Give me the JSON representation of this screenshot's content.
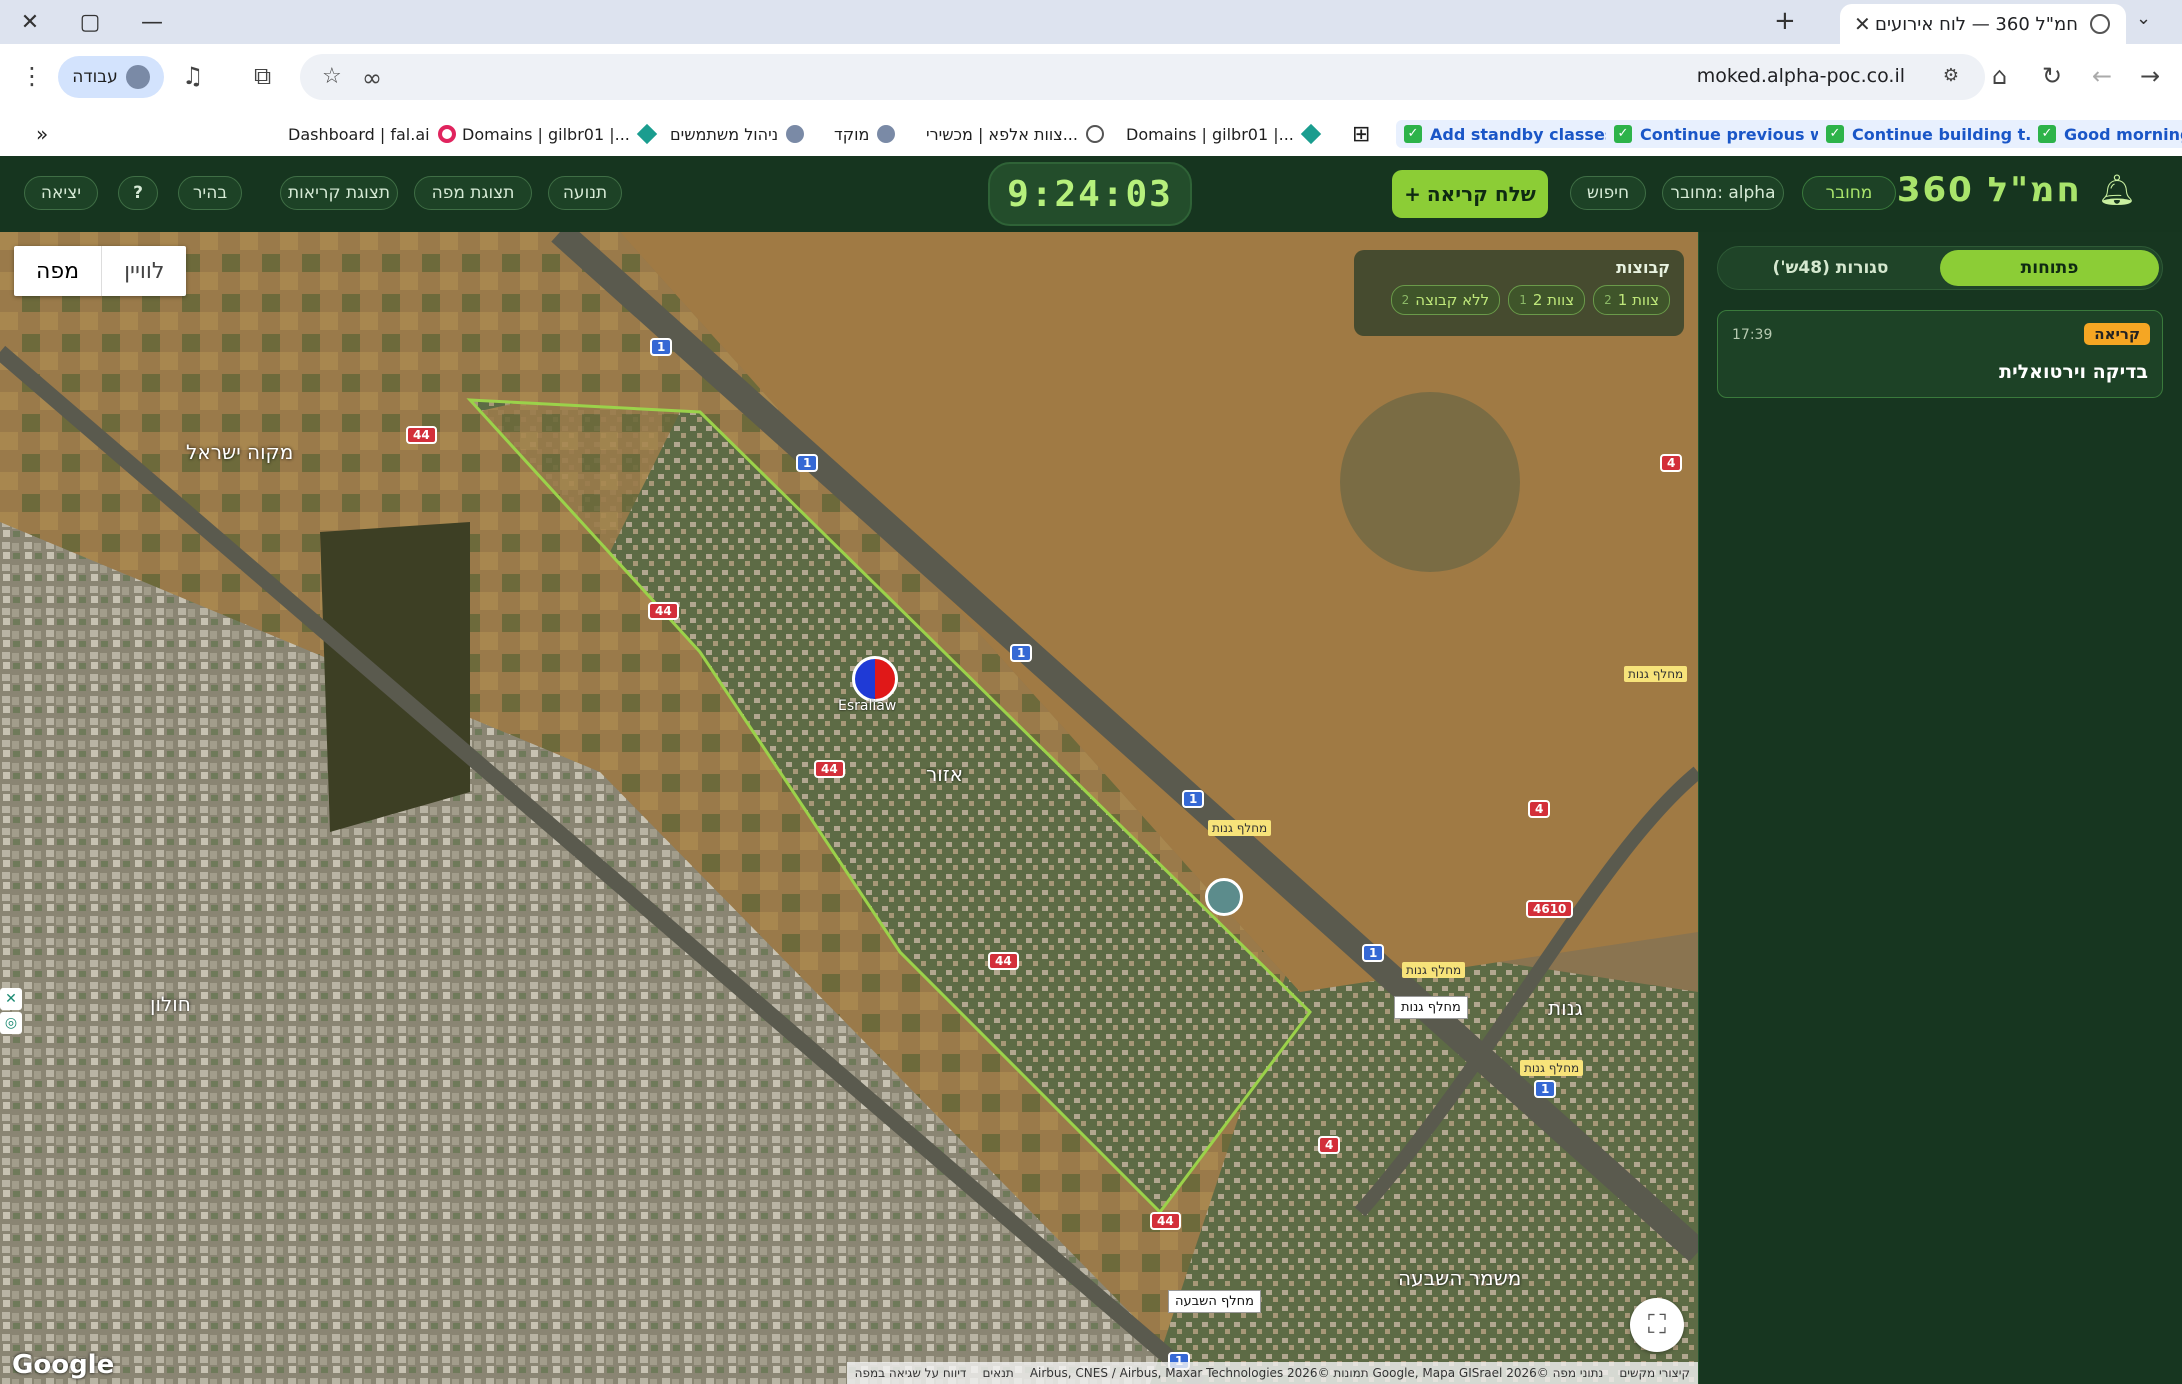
{
  "browser": {
    "tab_title": "חמ\"ל 360 — לוח אירועים",
    "url": "moked.alpha-poc.co.il",
    "profile_label": "עבודה",
    "bookmarks": [
      {
        "label": "Good morning",
        "icon": "checkbox-icon",
        "task": true
      },
      {
        "label": "Continue building t...",
        "icon": "checkbox-icon",
        "task": true
      },
      {
        "label": "Continue previous w...",
        "icon": "checkbox-icon",
        "task": true
      },
      {
        "label": "Add standby classes...",
        "icon": "checkbox-icon",
        "task": true
      },
      {
        "label": "Domains | gilbr01 |...",
        "icon": "diamond-icon"
      },
      {
        "label": "צוות אלפא | מכשירי...",
        "icon": "globe-icon"
      },
      {
        "label": "מוקד",
        "icon": "avatar-icon"
      },
      {
        "label": "ניהול משתמשים",
        "icon": "avatar-icon"
      },
      {
        "label": "Domains | gilbr01 |...",
        "icon": "diamond-icon"
      },
      {
        "label": "Dashboard | fal.ai",
        "icon": "ring-icon"
      }
    ]
  },
  "app": {
    "brand": "חמ\"ל 360",
    "status_connected": "מחובר",
    "connected_as": "מחובר: alpha",
    "search": "חיפוש",
    "send_call": "שלח קריאה",
    "clock": "9:24:03",
    "nav": {
      "movement": "תנועה",
      "map_view": "תצוגת מפה",
      "calls_view": "תצוגת קריאות",
      "bright": "בהיר",
      "help": "?",
      "exit": "יציאה"
    }
  },
  "map": {
    "type_map": "מפה",
    "type_satellite": "לוויין",
    "groups": {
      "title": "קבוצות",
      "chips": [
        {
          "label": "צוות 1",
          "count": "2"
        },
        {
          "label": "צוות 2",
          "count": "1"
        },
        {
          "label": "ללא קבוצה",
          "count": "2"
        }
      ]
    },
    "marker_label": "Esraliaw",
    "road_labels": [
      "מחלף גנות",
      "מחלף גנות",
      "מחלף גנות",
      "מחלף גנות"
    ],
    "box_labels": [
      "מחלף גנות",
      "מחלף השבעה"
    ],
    "place_labels": [
      "מקוה ישראל",
      "אזור",
      "גנות",
      "משמר השבעה",
      "חולון"
    ],
    "shields": [
      "44",
      "1",
      "1",
      "1",
      "44",
      "44",
      "1",
      "1",
      "4",
      "4610",
      "1",
      "44",
      "4",
      "44",
      "1",
      "4"
    ],
    "google": "Google",
    "attribution": [
      "קיצורי מקשים",
      "נתוני מפה ©2026 Google, Mapa GISrael תמונות ©2026 Airbus, CNES / Airbus, Maxar Technologies",
      "תנאים",
      "דיווח על שגיאה במפה"
    ]
  },
  "panel": {
    "tab_open": "פתוחות",
    "tab_closed": "סגורות (48ש')",
    "incidents": [
      {
        "badge": "קריאה",
        "time": "17:39",
        "title": "בדיקה וירטואלית"
      }
    ]
  },
  "colors": {
    "accent": "#8ccd36",
    "brand_text": "#a9e46b",
    "panel_bg": "#173620",
    "badge": "#f5a623"
  }
}
